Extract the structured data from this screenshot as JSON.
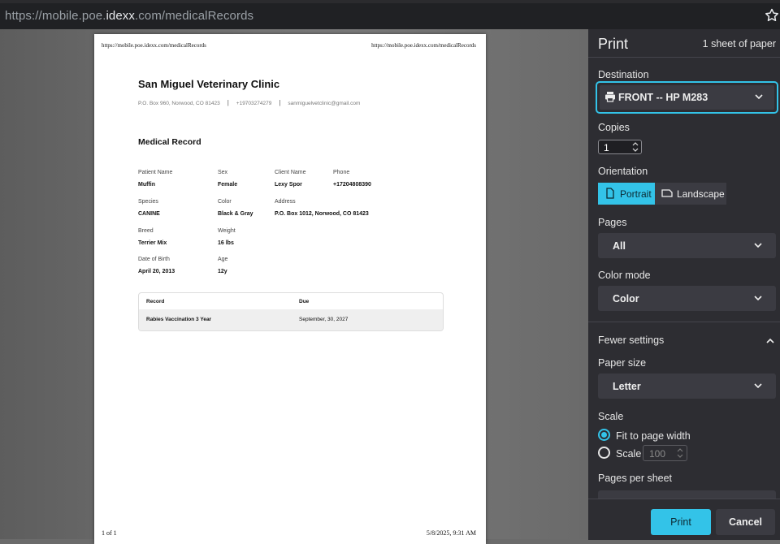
{
  "browser": {
    "url_prefix": "https://mobile.poe.",
    "url_domain": "idexx",
    "url_suffix": ".com/medicalRecords"
  },
  "document": {
    "header_left": "https://mobile.poe.idexx.com/medicalRecords",
    "header_right": "https://mobile.poe.idexx.com/medicalRecords",
    "clinic_name": "San Miguel Veterinary Clinic",
    "clinic_address": "P.O. Box 960, Norwood, CO 81423",
    "clinic_phone": "+19703274279",
    "clinic_email": "sanmiguelvetclinic@gmail.com",
    "section_title": "Medical Record",
    "fields": {
      "patient_name_label": "Patient Name",
      "patient_name": "Muffin",
      "sex_label": "Sex",
      "sex": "Female",
      "client_name_label": "Client Name",
      "client_name": "Lexy Spor",
      "phone_label": "Phone",
      "phone": "+17204808390",
      "species_label": "Species",
      "species": "CANINE",
      "color_label": "Color",
      "color": "Black & Gray",
      "address_label": "Address",
      "address": "P.O. Box 1012, Norwood, CO 81423",
      "breed_label": "Breed",
      "breed": "Terrier Mix",
      "weight_label": "Weight",
      "weight": "16 lbs",
      "dob_label": "Date of Birth",
      "dob": "April 20, 2013",
      "age_label": "Age",
      "age": "12y"
    },
    "records_table": {
      "col_record": "Record",
      "col_due": "Due",
      "rows": [
        {
          "record": "Rabies Vaccination 3 Year",
          "due": "September, 30, 2027"
        }
      ]
    },
    "footer_left": "1 of 1",
    "footer_right": "5/8/2025, 9:31 AM"
  },
  "print_panel": {
    "title": "Print",
    "sheets": "1 sheet of paper",
    "destination_label": "Destination",
    "destination_value": "FRONT -- HP M283",
    "copies_label": "Copies",
    "copies_value": "1",
    "orientation_label": "Orientation",
    "orientation_portrait": "Portrait",
    "orientation_landscape": "Landscape",
    "orientation_selected": "Portrait",
    "pages_label": "Pages",
    "pages_value": "All",
    "color_mode_label": "Color mode",
    "color_mode_value": "Color",
    "fewer_settings": "Fewer settings",
    "paper_size_label": "Paper size",
    "paper_size_value": "Letter",
    "scale_label": "Scale",
    "scale_fit": "Fit to page width",
    "scale_custom": "Scale",
    "scale_value": "100",
    "scale_selected": "Fit to page width",
    "pages_per_sheet_label": "Pages per sheet",
    "print_button": "Print",
    "cancel_button": "Cancel"
  },
  "colors": {
    "accent": "#33c3e8",
    "panel_bg": "#2d2d32",
    "control_bg": "#3b3b42"
  }
}
